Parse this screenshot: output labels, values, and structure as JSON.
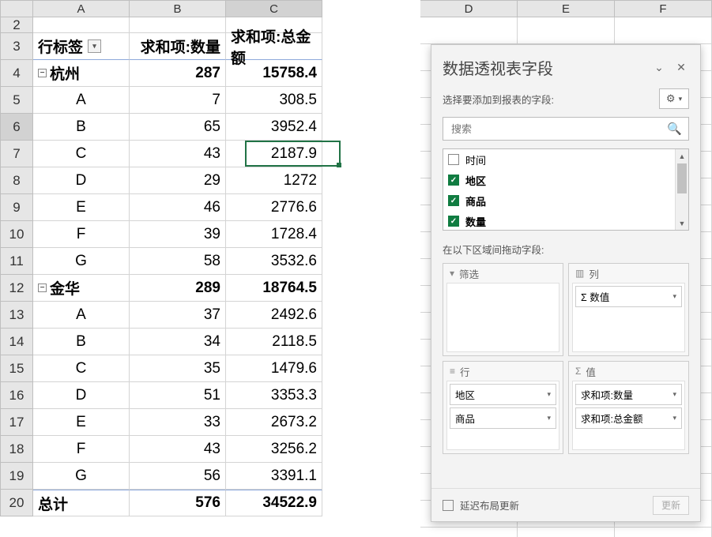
{
  "columns": [
    "A",
    "B",
    "C",
    "D",
    "E",
    "F"
  ],
  "row_numbers": [
    2,
    3,
    4,
    5,
    6,
    7,
    8,
    9,
    10,
    11,
    12,
    13,
    14,
    15,
    16,
    17,
    18,
    19,
    20
  ],
  "active_cell": {
    "row": 6,
    "col": "C"
  },
  "pivot": {
    "headers": {
      "row_label": "行标签",
      "qty": "求和项:数量",
      "amt": "求和项:总金额"
    },
    "groups": [
      {
        "name": "杭州",
        "qty": 287,
        "amt": "15758.4",
        "items": [
          {
            "k": "A",
            "q": 7,
            "a": "308.5"
          },
          {
            "k": "B",
            "q": 65,
            "a": "3952.4"
          },
          {
            "k": "C",
            "q": 43,
            "a": "2187.9"
          },
          {
            "k": "D",
            "q": 29,
            "a": "1272"
          },
          {
            "k": "E",
            "q": 46,
            "a": "2776.6"
          },
          {
            "k": "F",
            "q": 39,
            "a": "1728.4"
          },
          {
            "k": "G",
            "q": 58,
            "a": "3532.6"
          }
        ]
      },
      {
        "name": "金华",
        "qty": 289,
        "amt": "18764.5",
        "items": [
          {
            "k": "A",
            "q": 37,
            "a": "2492.6"
          },
          {
            "k": "B",
            "q": 34,
            "a": "2118.5"
          },
          {
            "k": "C",
            "q": 35,
            "a": "1479.6"
          },
          {
            "k": "D",
            "q": 51,
            "a": "3353.3"
          },
          {
            "k": "E",
            "q": 33,
            "a": "2673.2"
          },
          {
            "k": "F",
            "q": 43,
            "a": "3256.2"
          },
          {
            "k": "G",
            "q": 56,
            "a": "3391.1"
          }
        ]
      }
    ],
    "total": {
      "label": "总计",
      "qty": 576,
      "amt": "34522.9"
    }
  },
  "pane": {
    "title": "数据透视表字段",
    "subtitle": "选择要添加到报表的字段:",
    "search_placeholder": "搜索",
    "fields": [
      {
        "label": "时间",
        "checked": false
      },
      {
        "label": "地区",
        "checked": true
      },
      {
        "label": "商品",
        "checked": true
      },
      {
        "label": "数量",
        "checked": true
      }
    ],
    "drag_label": "在以下区域间拖动字段:",
    "zones": {
      "filter": {
        "label": "筛选",
        "items": []
      },
      "columns": {
        "label": "列",
        "items": [
          "Σ 数值"
        ]
      },
      "rows": {
        "label": "行",
        "items": [
          "地区",
          "商品"
        ]
      },
      "values": {
        "label": "值",
        "items": [
          "求和项:数量",
          "求和项:总金额"
        ]
      }
    },
    "defer_label": "延迟布局更新",
    "update_label": "更新"
  },
  "glyph": {
    "sigma": "Σ",
    "funnel": "▼",
    "bars": "▥",
    "list": "≡"
  }
}
